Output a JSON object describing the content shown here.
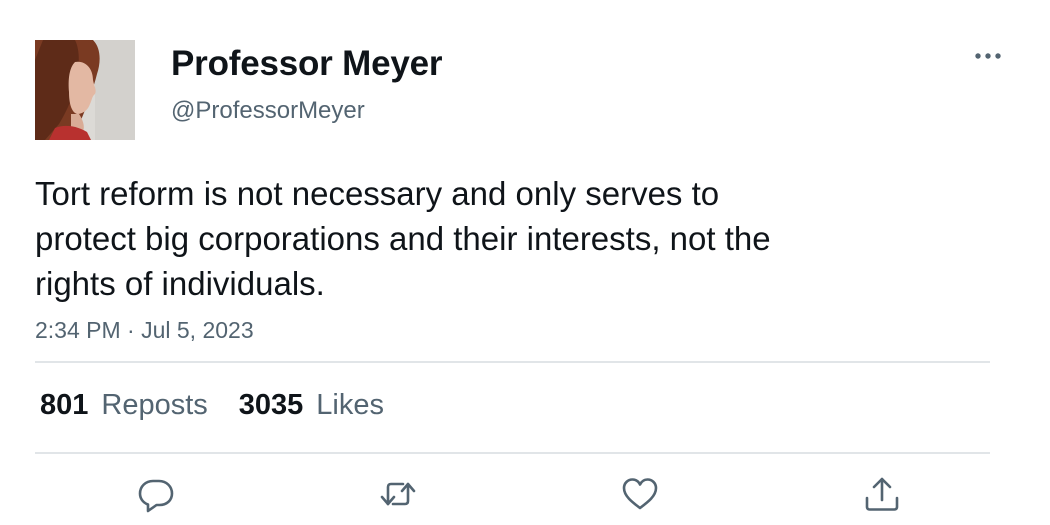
{
  "author": {
    "display_name": "Professor Meyer",
    "handle": "@ProfessorMeyer",
    "avatar_icon": "profile-photo"
  },
  "tweet": {
    "text_lines": [
      "Tort reform is not necessary and only serves to",
      "protect big corporations and their interests, not the",
      "rights of individuals."
    ],
    "timestamp": "2:34 PM · Jul 5, 2023"
  },
  "stats": {
    "reposts_count": "801",
    "reposts_label": "Reposts",
    "likes_count": "3035",
    "likes_label": "Likes"
  },
  "actions": {
    "reply_icon": "reply-icon",
    "repost_icon": "repost-icon",
    "like_icon": "like-icon",
    "share_icon": "share-icon",
    "more_icon": "more-icon"
  },
  "colors": {
    "text": "#0f1419",
    "secondary": "#536471",
    "divider": "#e1e5e8"
  }
}
